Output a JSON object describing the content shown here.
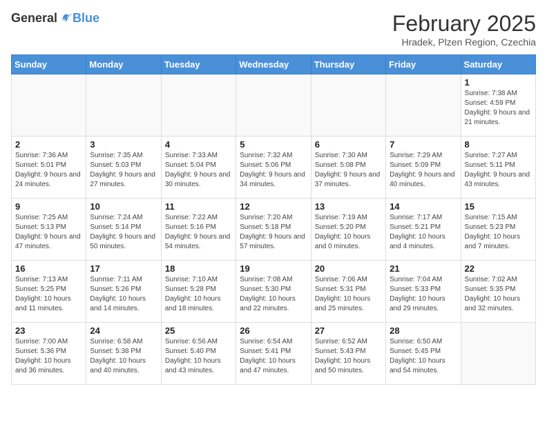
{
  "header": {
    "logo_general": "General",
    "logo_blue": "Blue",
    "month_title": "February 2025",
    "location": "Hradek, Plzen Region, Czechia"
  },
  "weekdays": [
    "Sunday",
    "Monday",
    "Tuesday",
    "Wednesday",
    "Thursday",
    "Friday",
    "Saturday"
  ],
  "weeks": [
    [
      {
        "day": "",
        "info": ""
      },
      {
        "day": "",
        "info": ""
      },
      {
        "day": "",
        "info": ""
      },
      {
        "day": "",
        "info": ""
      },
      {
        "day": "",
        "info": ""
      },
      {
        "day": "",
        "info": ""
      },
      {
        "day": "1",
        "info": "Sunrise: 7:38 AM\nSunset: 4:59 PM\nDaylight: 9 hours and 21 minutes."
      }
    ],
    [
      {
        "day": "2",
        "info": "Sunrise: 7:36 AM\nSunset: 5:01 PM\nDaylight: 9 hours and 24 minutes."
      },
      {
        "day": "3",
        "info": "Sunrise: 7:35 AM\nSunset: 5:03 PM\nDaylight: 9 hours and 27 minutes."
      },
      {
        "day": "4",
        "info": "Sunrise: 7:33 AM\nSunset: 5:04 PM\nDaylight: 9 hours and 30 minutes."
      },
      {
        "day": "5",
        "info": "Sunrise: 7:32 AM\nSunset: 5:06 PM\nDaylight: 9 hours and 34 minutes."
      },
      {
        "day": "6",
        "info": "Sunrise: 7:30 AM\nSunset: 5:08 PM\nDaylight: 9 hours and 37 minutes."
      },
      {
        "day": "7",
        "info": "Sunrise: 7:29 AM\nSunset: 5:09 PM\nDaylight: 9 hours and 40 minutes."
      },
      {
        "day": "8",
        "info": "Sunrise: 7:27 AM\nSunset: 5:11 PM\nDaylight: 9 hours and 43 minutes."
      }
    ],
    [
      {
        "day": "9",
        "info": "Sunrise: 7:25 AM\nSunset: 5:13 PM\nDaylight: 9 hours and 47 minutes."
      },
      {
        "day": "10",
        "info": "Sunrise: 7:24 AM\nSunset: 5:14 PM\nDaylight: 9 hours and 50 minutes."
      },
      {
        "day": "11",
        "info": "Sunrise: 7:22 AM\nSunset: 5:16 PM\nDaylight: 9 hours and 54 minutes."
      },
      {
        "day": "12",
        "info": "Sunrise: 7:20 AM\nSunset: 5:18 PM\nDaylight: 9 hours and 57 minutes."
      },
      {
        "day": "13",
        "info": "Sunrise: 7:19 AM\nSunset: 5:20 PM\nDaylight: 10 hours and 0 minutes."
      },
      {
        "day": "14",
        "info": "Sunrise: 7:17 AM\nSunset: 5:21 PM\nDaylight: 10 hours and 4 minutes."
      },
      {
        "day": "15",
        "info": "Sunrise: 7:15 AM\nSunset: 5:23 PM\nDaylight: 10 hours and 7 minutes."
      }
    ],
    [
      {
        "day": "16",
        "info": "Sunrise: 7:13 AM\nSunset: 5:25 PM\nDaylight: 10 hours and 11 minutes."
      },
      {
        "day": "17",
        "info": "Sunrise: 7:11 AM\nSunset: 5:26 PM\nDaylight: 10 hours and 14 minutes."
      },
      {
        "day": "18",
        "info": "Sunrise: 7:10 AM\nSunset: 5:28 PM\nDaylight: 10 hours and 18 minutes."
      },
      {
        "day": "19",
        "info": "Sunrise: 7:08 AM\nSunset: 5:30 PM\nDaylight: 10 hours and 22 minutes."
      },
      {
        "day": "20",
        "info": "Sunrise: 7:06 AM\nSunset: 5:31 PM\nDaylight: 10 hours and 25 minutes."
      },
      {
        "day": "21",
        "info": "Sunrise: 7:04 AM\nSunset: 5:33 PM\nDaylight: 10 hours and 29 minutes."
      },
      {
        "day": "22",
        "info": "Sunrise: 7:02 AM\nSunset: 5:35 PM\nDaylight: 10 hours and 32 minutes."
      }
    ],
    [
      {
        "day": "23",
        "info": "Sunrise: 7:00 AM\nSunset: 5:36 PM\nDaylight: 10 hours and 36 minutes."
      },
      {
        "day": "24",
        "info": "Sunrise: 6:58 AM\nSunset: 5:38 PM\nDaylight: 10 hours and 40 minutes."
      },
      {
        "day": "25",
        "info": "Sunrise: 6:56 AM\nSunset: 5:40 PM\nDaylight: 10 hours and 43 minutes."
      },
      {
        "day": "26",
        "info": "Sunrise: 6:54 AM\nSunset: 5:41 PM\nDaylight: 10 hours and 47 minutes."
      },
      {
        "day": "27",
        "info": "Sunrise: 6:52 AM\nSunset: 5:43 PM\nDaylight: 10 hours and 50 minutes."
      },
      {
        "day": "28",
        "info": "Sunrise: 6:50 AM\nSunset: 5:45 PM\nDaylight: 10 hours and 54 minutes."
      },
      {
        "day": "",
        "info": ""
      }
    ]
  ]
}
